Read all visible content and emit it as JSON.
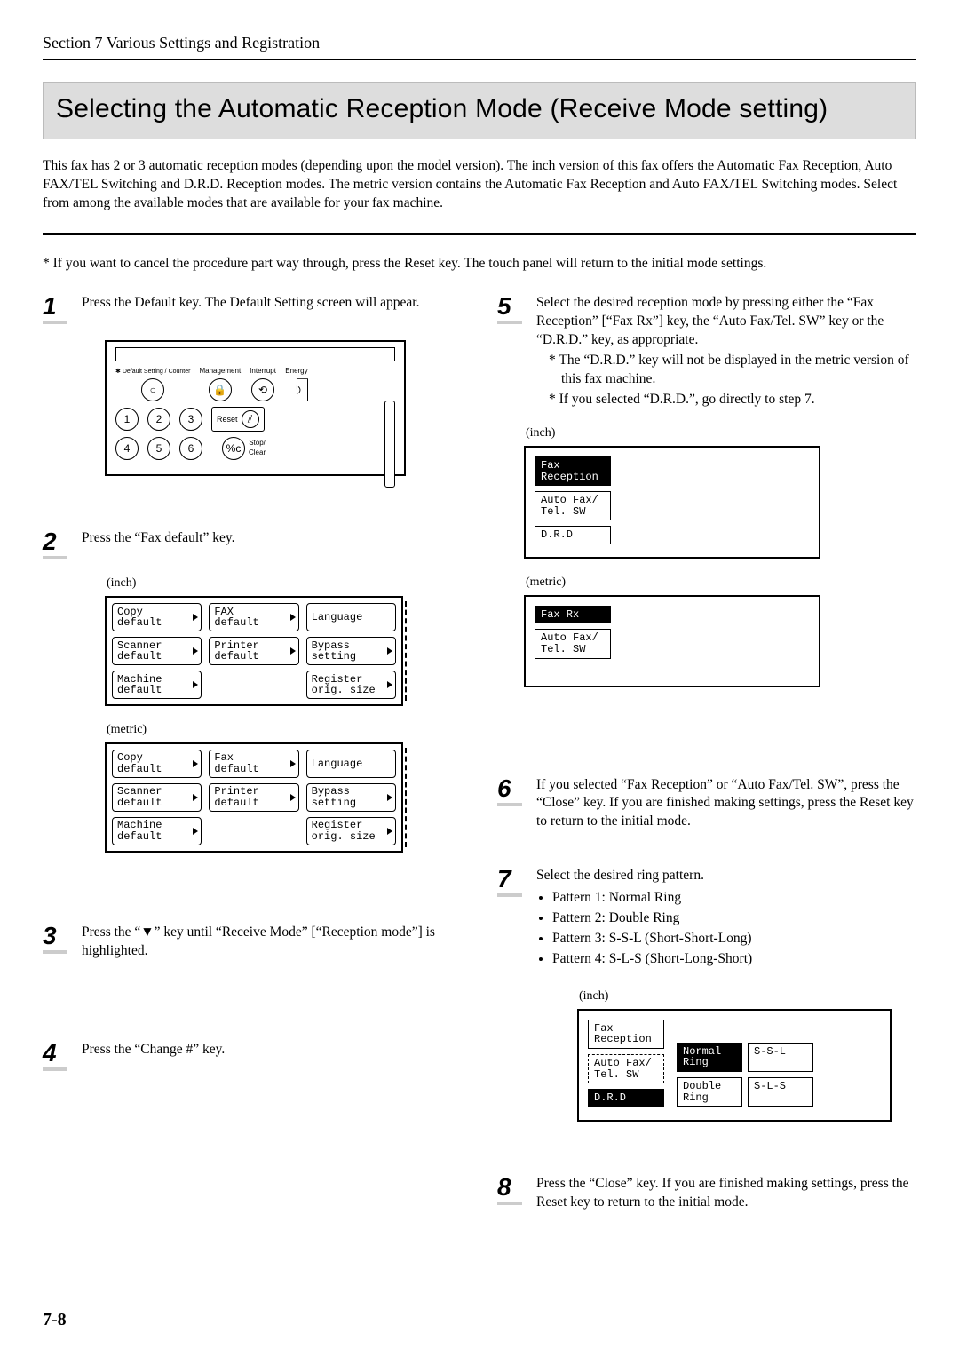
{
  "section_header": "Section 7   Various Settings and Registration",
  "title": "Selecting the Automatic Reception Mode  (Receive Mode setting)",
  "intro": "This fax has 2 or 3 automatic reception modes (depending upon the model version). The inch version of this fax offers the Automatic Fax Reception, Auto FAX/TEL Switching and D.R.D. Reception modes. The metric version contains the Automatic Fax Reception and Auto FAX/TEL Switching modes. Select from among the available modes that are available for your fax machine.",
  "cancel_note": "* If you want to cancel the procedure part way through, press the Reset key. The touch panel will return to the initial mode settings.",
  "step1": {
    "num": "1",
    "text": "Press the Default key. The Default Setting screen will appear.",
    "panel": {
      "defsetting": "Default Setting / Counter",
      "mgmt": "Management",
      "interrupt": "Interrupt",
      "energy": "Energy",
      "reset": "Reset",
      "stopclear": "Stop/\nClear",
      "keys": [
        "1",
        "2",
        "3",
        "4",
        "5",
        "6"
      ]
    }
  },
  "step2": {
    "num": "2",
    "text": "Press the “Fax default” key.",
    "cap_inch": "(inch)",
    "cap_metric": "(metric)",
    "inch_rows": [
      [
        "Copy\ndefault",
        "FAX\ndefault",
        "Language"
      ],
      [
        "Scanner\ndefault",
        "Printer\ndefault",
        "Bypass\nsetting"
      ],
      [
        "Machine\ndefault",
        "",
        "Register\norig. size"
      ]
    ],
    "metric_rows": [
      [
        "Copy\ndefault",
        "Fax\ndefault",
        "Language"
      ],
      [
        "Scanner\ndefault",
        "Printer\ndefault",
        "Bypass\nsetting"
      ],
      [
        "Machine\ndefault",
        "",
        "Register\norig. size"
      ]
    ]
  },
  "step3": {
    "num": "3",
    "text": "Press the “▼” key until “Receive Mode” [“Reception mode”] is highlighted."
  },
  "step4": {
    "num": "4",
    "text": "Press the “Change #” key."
  },
  "step5": {
    "num": "5",
    "text": "Select the desired reception mode by pressing either the “Fax Reception” [“Fax Rx”] key, the “Auto Fax/Tel. SW” key or the “D.R.D.” key, as appropriate.",
    "bullets": [
      "* The “D.R.D.” key will not be displayed in the metric version of this fax machine.",
      "* If you selected “D.R.D.”, go directly to step 7."
    ],
    "cap_inch": "(inch)",
    "cap_metric": "(metric)",
    "inch_btns": [
      "Fax\nReception",
      "Auto Fax/\nTel. SW",
      "D.R.D"
    ],
    "metric_btns": [
      "Fax Rx",
      "Auto Fax/\nTel. SW"
    ]
  },
  "step6": {
    "num": "6",
    "text": "If you selected “Fax Reception” or “Auto Fax/Tel. SW”, press the “Close” key. If you are finished making settings, press the Reset key to return to the initial mode."
  },
  "step7": {
    "num": "7",
    "text": "Select the desired ring pattern.",
    "patterns": [
      "Pattern 1: Normal Ring",
      "Pattern 2: Double Ring",
      "Pattern 3: S-S-L (Short-Short-Long)",
      "Pattern 4: S-L-S (Short-Long-Short)"
    ],
    "cap_inch": "(inch)",
    "left_btns": [
      "Fax\nReception",
      "Auto Fax/\nTel. SW",
      "D.R.D"
    ],
    "ring_btns": [
      [
        "Normal\nRing",
        "S-S-L"
      ],
      [
        "Double\nRing",
        "S-L-S"
      ]
    ]
  },
  "step8": {
    "num": "8",
    "text": "Press the “Close” key. If you are finished making settings, press the Reset key to return to the initial mode."
  },
  "page_number": "7-8"
}
